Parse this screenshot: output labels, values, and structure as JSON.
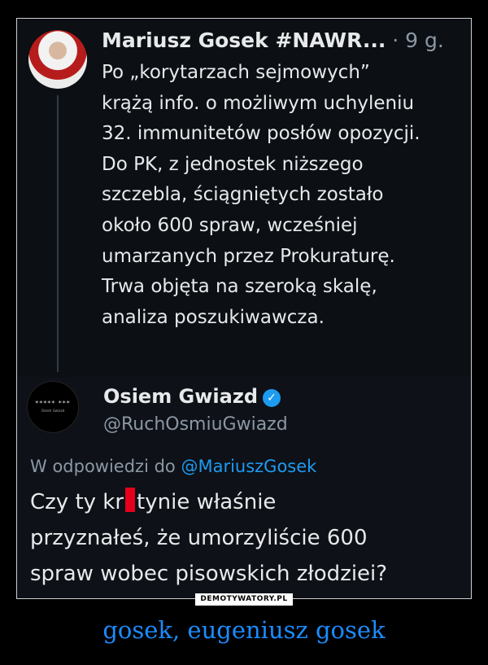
{
  "tweet1": {
    "name": "Mariusz Gosek #NAWR...",
    "time": "· 9 g.",
    "lines": [
      "Po „korytarzach sejmowych”",
      "krążą info. o możliwym uchyleniu",
      "32. immunitetów posłów opozycji.",
      "Do PK, z jednostek niższego",
      "szczebla, ściągniętych zostało",
      "około 600 spraw, wcześniej",
      "umarzanych przez Prokuraturę.",
      "Trwa objęta na szeroką skalę,",
      "analiza poszukiwawcza."
    ]
  },
  "tweet2": {
    "name": "Osiem Gwiazd",
    "handle": "@RuchOsmiuGwiazd",
    "avatar_text": "***** ***",
    "avatar_sub": "Osiem Gwiazd",
    "replying_prefix": "W odpowiedzi do ",
    "replying_mention": "@MariuszGosek",
    "reply_line1_a": "Czy ty kr",
    "reply_line1_b": "tynie właśnie",
    "reply_line2": "przyznałeś, że umorzyliście 600",
    "reply_line3": "spraw wobec pisowskich złodziei?"
  },
  "watermark": "DEMOTYWATORY.PL",
  "caption": "gosek, eugeniusz gosek",
  "colors": {
    "background": "#000000",
    "tweet_bg": "#0e1117",
    "text": "#e7e9ea",
    "muted": "#8b98a5",
    "link": "#1d9bf0",
    "caption": "#1a8cff",
    "censor": "#e4001b"
  },
  "icons": {
    "verified": "verified-badge-icon"
  }
}
